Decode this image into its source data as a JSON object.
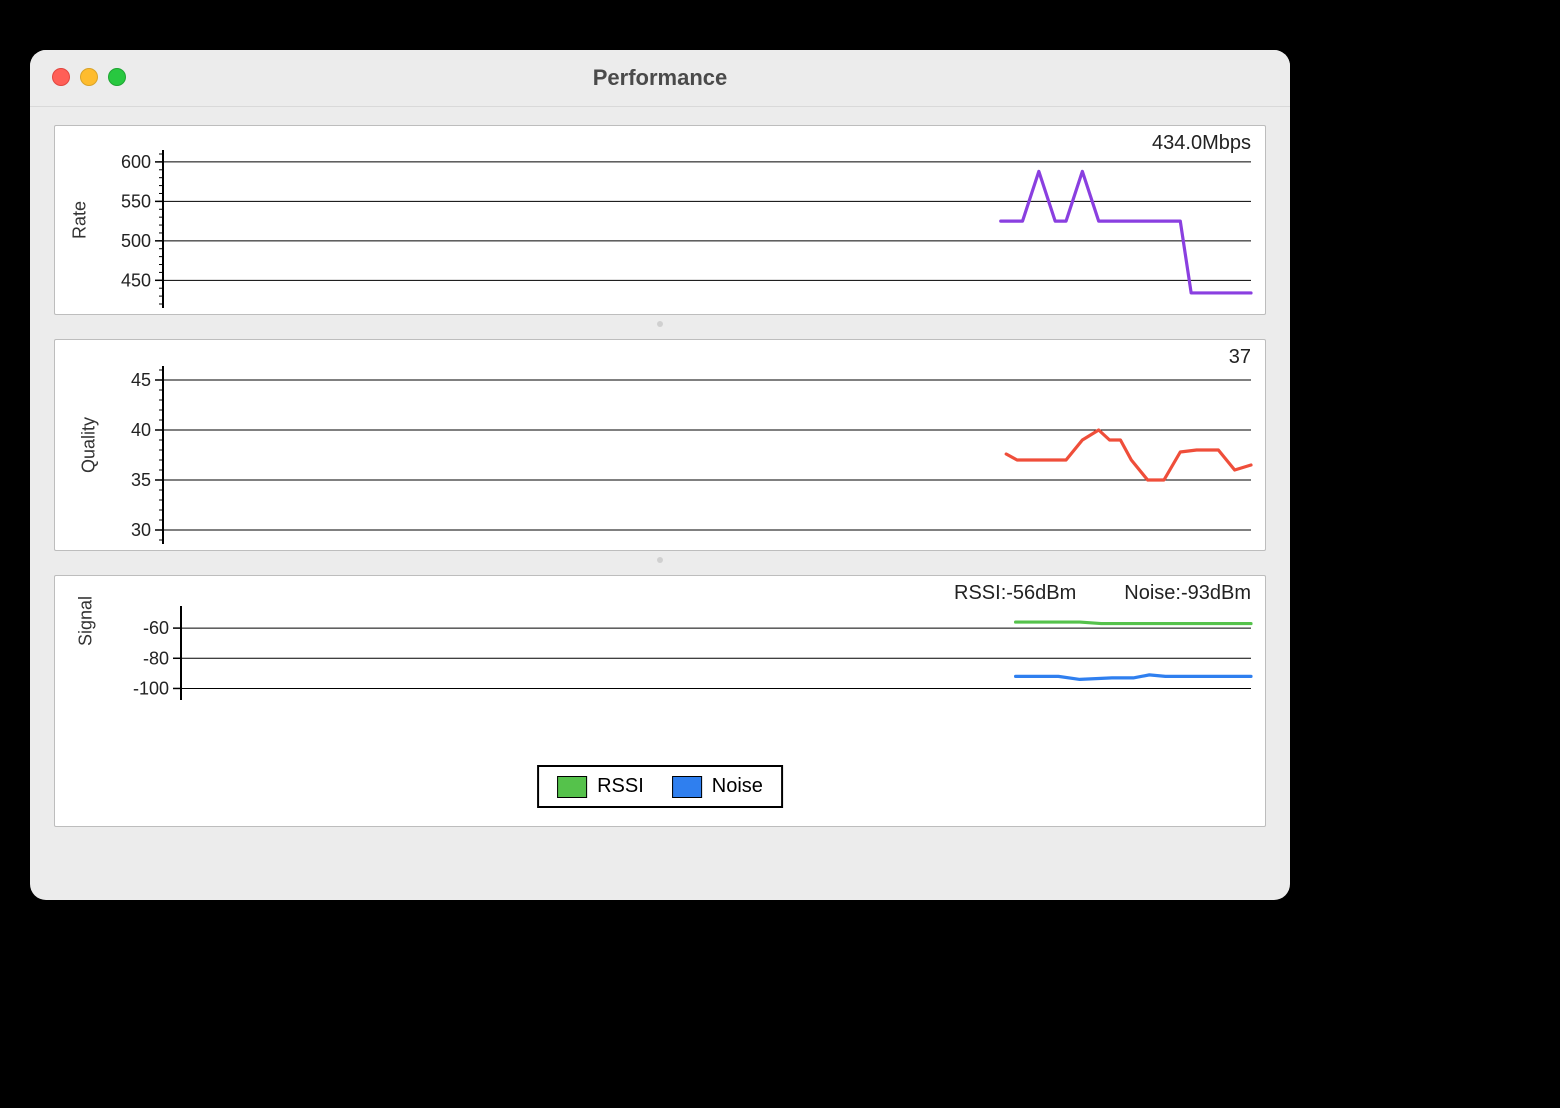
{
  "window": {
    "title": "Performance"
  },
  "rate": {
    "ylabel": "Rate",
    "current_label": "434.0Mbps",
    "yticks": [
      450,
      500,
      550,
      600
    ],
    "ylim": [
      420,
      610
    ]
  },
  "quality": {
    "ylabel": "Quality",
    "current_label": "37",
    "yticks": [
      30,
      35,
      40,
      45
    ],
    "ylim": [
      29,
      46
    ]
  },
  "signal": {
    "ylabel": "Signal",
    "rssi_label": "RSSI:-56dBm",
    "noise_label": "Noise:-93dBm",
    "yticks": [
      -60,
      -80,
      -100
    ],
    "ylim": [
      -105,
      -48
    ]
  },
  "legend": {
    "rssi": "RSSI",
    "noise": "Noise"
  },
  "chart_data": [
    {
      "type": "line",
      "name": "Rate",
      "ylabel": "Rate",
      "ylim": [
        420,
        610
      ],
      "yticks": [
        450,
        500,
        550,
        600
      ],
      "x_range": [
        0,
        100
      ],
      "series": [
        {
          "name": "Rate",
          "color": "#8a3fe0",
          "x": [
            77,
            79,
            80.5,
            82,
            83,
            84.5,
            86,
            87,
            88,
            93.5,
            94.5,
            100
          ],
          "values": [
            525,
            525,
            588,
            525,
            525,
            588,
            525,
            525,
            525,
            525,
            434,
            434
          ]
        }
      ],
      "current_value": 434.0,
      "current_unit": "Mbps"
    },
    {
      "type": "line",
      "name": "Quality",
      "ylabel": "Quality",
      "ylim": [
        29,
        46
      ],
      "yticks": [
        30,
        35,
        40,
        45
      ],
      "x_range": [
        0,
        100
      ],
      "series": [
        {
          "name": "Quality",
          "color": "#ef4e3a",
          "x": [
            77.5,
            78.5,
            79.5,
            83,
            84.5,
            86,
            87,
            88,
            89,
            90.5,
            92,
            93.5,
            95,
            97,
            98.5,
            100
          ],
          "values": [
            37.6,
            37,
            37,
            37,
            39,
            40,
            39,
            39,
            37,
            35,
            35,
            37.8,
            38,
            38,
            36,
            36.5
          ]
        }
      ],
      "current_value": 37
    },
    {
      "type": "line",
      "name": "Signal",
      "ylabel": "Signal",
      "ylim": [
        -105,
        -48
      ],
      "yticks": [
        -60,
        -80,
        -100
      ],
      "x_range": [
        0,
        100
      ],
      "series": [
        {
          "name": "RSSI",
          "color": "#55c24b",
          "x": [
            78,
            84,
            86,
            100
          ],
          "values": [
            -56,
            -56,
            -57,
            -57
          ]
        },
        {
          "name": "Noise",
          "color": "#2f7fef",
          "x": [
            78,
            82,
            84,
            87,
            89,
            90.5,
            92,
            100
          ],
          "values": [
            -92,
            -92,
            -94,
            -93,
            -93,
            -91,
            -92,
            -92
          ]
        }
      ],
      "current_rssi": -56,
      "current_noise": -93,
      "unit": "dBm"
    }
  ]
}
